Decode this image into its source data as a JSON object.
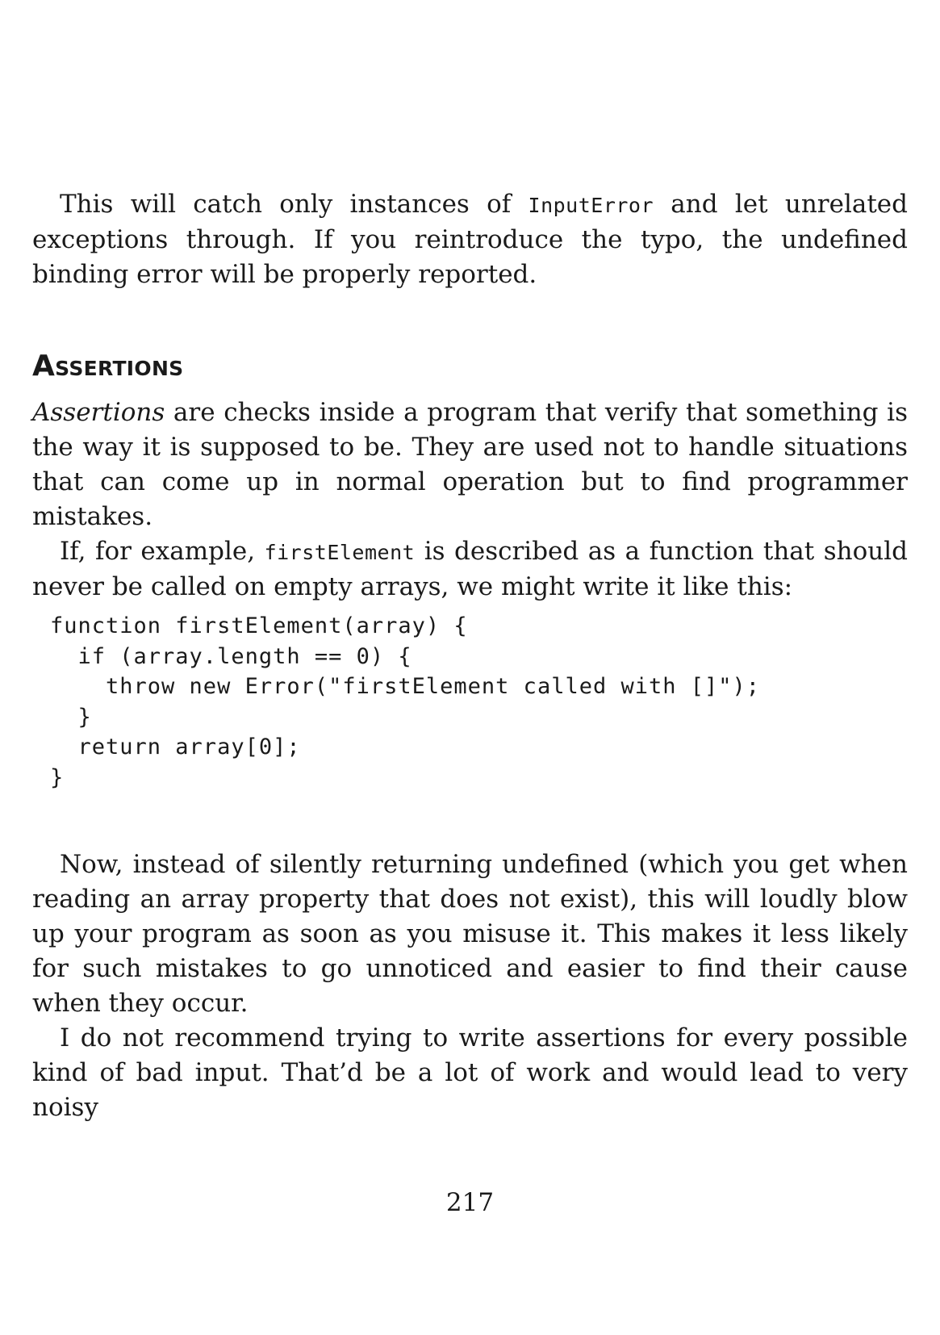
{
  "paragraph_1": {
    "text_before": "This will catch only instances of ",
    "code": "InputError",
    "text_after": " and let unrelated exceptions through. If you reintroduce the typo, the undefined binding error will be properly reported."
  },
  "section_heading": "Assertions",
  "paragraph_2": {
    "emphasis": "Assertions",
    "text": " are checks inside a program that verify that something is the way it is supposed to be. They are used not to handle situations that can come up in normal operation but to find programmer mistakes."
  },
  "paragraph_3": {
    "text_before": "If, for example, ",
    "code": "firstElement",
    "text_after": " is described as a function that should never be called on empty arrays, we might write it like this:"
  },
  "code_block": {
    "lines": [
      "function firstElement(array) {",
      "  if (array.length == 0) {",
      "    throw new Error(\"firstElement called with []\");",
      "  }",
      "  return array[0];",
      "}"
    ]
  },
  "paragraph_4": "Now, instead of silently returning undefined (which you get when reading an array property that does not exist), this will loudly blow up your program as soon as you misuse it. This makes it less likely for such mistakes to go unnoticed and easier to find their cause when they occur.",
  "paragraph_5": "I do not recommend trying to write assertions for every possible kind of bad input. That’d be a lot of work and would lead to very noisy",
  "page_number": "217"
}
